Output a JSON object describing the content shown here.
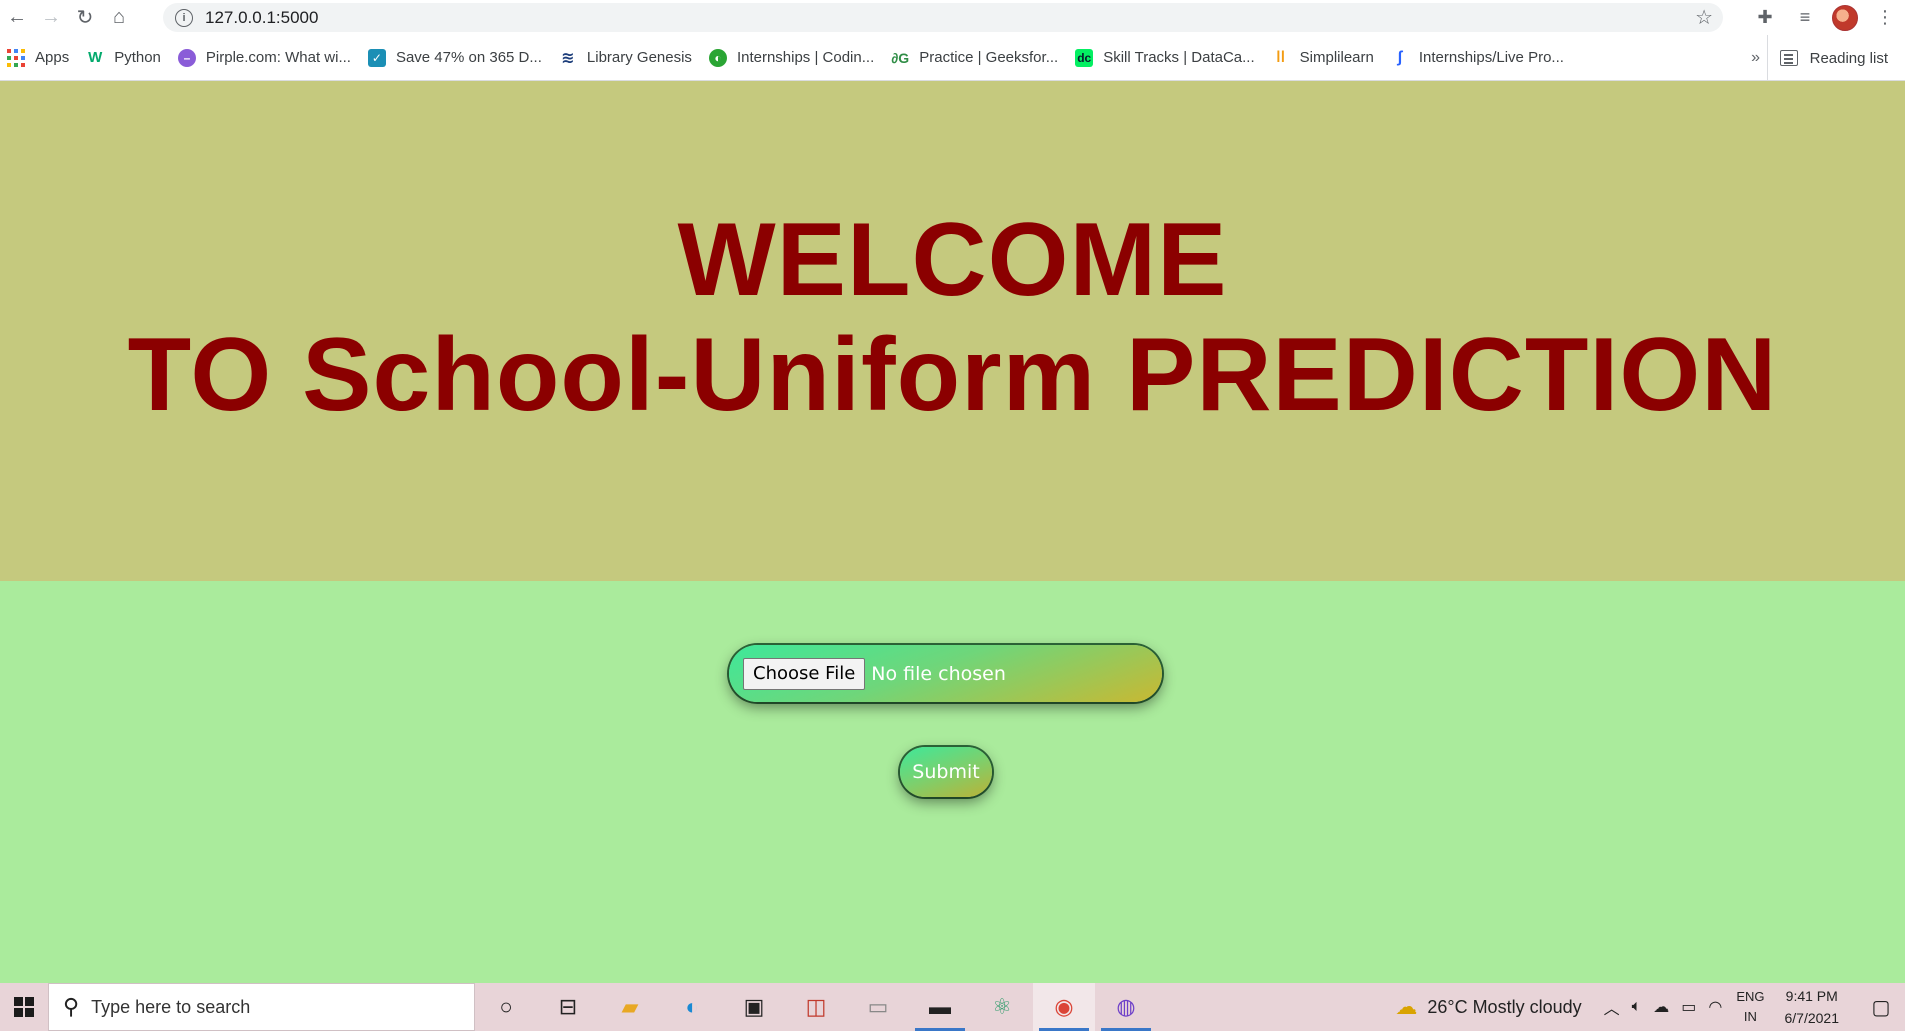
{
  "browser": {
    "url": "127.0.0.1:5000",
    "nav_icons": [
      "back-arrow-icon",
      "forward-arrow-icon",
      "reload-icon",
      "home-icon"
    ],
    "bookmarks": [
      {
        "label": "Apps",
        "icon": "apps-grid-icon"
      },
      {
        "label": "Python",
        "icon": "w3schools-icon",
        "color": "#04aa6d"
      },
      {
        "label": "Pirple.com: What wi...",
        "icon": "pirple-icon",
        "color": "#8a5cd8"
      },
      {
        "label": "Save 47% on 365 D...",
        "icon": "datacamp-save-icon",
        "color": "#1b8fb5"
      },
      {
        "label": "Library Genesis",
        "icon": "library-genesis-icon",
        "color": "#1c3d7a"
      },
      {
        "label": "Internships | Codin...",
        "icon": "internships-icon",
        "color": "#2aa534"
      },
      {
        "label": "Practice | Geeksfor...",
        "icon": "geeksforgeeks-icon",
        "color": "#2f8d46"
      },
      {
        "label": "Skill Tracks | DataCa...",
        "icon": "datacamp-icon",
        "color": "#03ef62"
      },
      {
        "label": "Simplilearn",
        "icon": "simplilearn-icon",
        "color": "#f39c12"
      },
      {
        "label": "Internships/Live Pro...",
        "icon": "internships-live-icon",
        "color": "#2962ff"
      }
    ],
    "more_label": "»",
    "reading_list_label": "Reading list"
  },
  "hero": {
    "line1": "WELCOME",
    "line2": "TO School-Uniform PREDICTION",
    "bg_color": "#c5c97e",
    "text_color": "#8b0000"
  },
  "form": {
    "choose_file_label": "Choose File",
    "no_file_label": "No file chosen",
    "submit_label": "Submit",
    "bg_color": "#aaeb9c"
  },
  "taskbar": {
    "search_placeholder": "Type here to search",
    "apps": [
      {
        "name": "cortana-icon",
        "glyph": "○"
      },
      {
        "name": "task-view-icon",
        "glyph": "⊟"
      },
      {
        "name": "file-explorer-icon",
        "glyph": "▰"
      },
      {
        "name": "edge-icon",
        "glyph": "◐"
      },
      {
        "name": "microsoft-store-icon",
        "glyph": "▣"
      },
      {
        "name": "gift-app-icon",
        "glyph": "◫"
      },
      {
        "name": "drive-icon",
        "glyph": "▭"
      },
      {
        "name": "terminal-icon",
        "glyph": "▬"
      },
      {
        "name": "atom-icon",
        "glyph": "⚛"
      },
      {
        "name": "chrome-icon",
        "glyph": "◉"
      },
      {
        "name": "github-desktop-icon",
        "glyph": "◍"
      }
    ],
    "weather": "26°C  Mostly cloudy",
    "lang_line1": "ENG",
    "lang_line2": "IN",
    "time": "9:41 PM",
    "date": "6/7/2021"
  }
}
